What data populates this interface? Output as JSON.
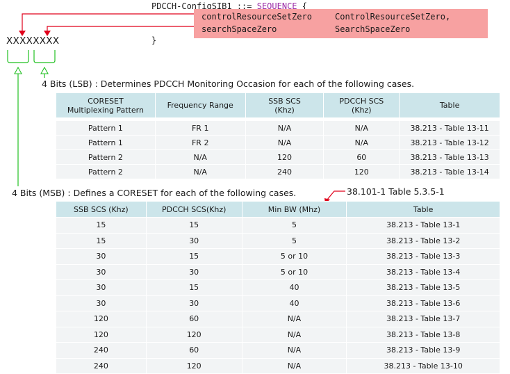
{
  "code": {
    "line1_name": "PDCCH-ConfigSIB1 ::=",
    "line1_kw": "SEQUENCE",
    "line1_brace": "{",
    "fields": [
      {
        "name": "controlResourceSetZero",
        "type": "ControlResourceSetZero,"
      },
      {
        "name": "searchSpaceZero",
        "type": "SearchSpaceZero"
      }
    ],
    "close": "}"
  },
  "bits": "XXXXXXXX",
  "lsb_label": "4 Bits (LSB) : Determines PDCCH Monitoring Occasion for each of the following cases.",
  "msb_label": "4 Bits (MSB) : Defines a CORESET for each of the following cases.",
  "ref_label": "38.101-1 Table 5.3.5-1",
  "colors": {
    "highlight": "#f7a1a1",
    "red_arrow": "#e0001b",
    "green_bracket": "#22c022",
    "header_bg": "#cce5ea",
    "cell_bg": "#f2f4f5",
    "keyword": "#9a2aa6"
  },
  "table1": {
    "headers": [
      [
        "CORESET",
        "Multiplexing Pattern"
      ],
      [
        "Frequency Range"
      ],
      [
        "SSB SCS",
        "(Khz)"
      ],
      [
        "PDCCH SCS",
        "(Khz)"
      ],
      [
        "Table"
      ]
    ],
    "rows": [
      [
        "Pattern 1",
        "FR 1",
        "N/A",
        "N/A",
        "38.213 - Table 13-11"
      ],
      [
        "Pattern 1",
        "FR 2",
        "N/A",
        "N/A",
        "38.213 - Table 13-12"
      ],
      [
        "Pattern 2",
        "N/A",
        "120",
        "60",
        "38.213 - Table 13-13"
      ],
      [
        "Pattern 2",
        "N/A",
        "240",
        "120",
        "38.213 - Table 13-14"
      ]
    ]
  },
  "table2": {
    "headers": [
      "SSB SCS (Khz)",
      "PDCCH SCS(Khz)",
      "Min BW (Mhz)",
      "Table"
    ],
    "rows": [
      [
        "15",
        "15",
        "5",
        "38.213 - Table 13-1"
      ],
      [
        "15",
        "30",
        "5",
        "38.213 - Table 13-2"
      ],
      [
        "30",
        "15",
        "5 or 10",
        "38.213 - Table 13-3"
      ],
      [
        "30",
        "30",
        "5 or 10",
        "38.213 - Table 13-4"
      ],
      [
        "30",
        "15",
        "40",
        "38.213 - Table 13-5"
      ],
      [
        "30",
        "30",
        "40",
        "38.213 - Table 13-6"
      ],
      [
        "120",
        "60",
        "N/A",
        "38.213 - Table 13-7"
      ],
      [
        "120",
        "120",
        "N/A",
        "38.213 - Table 13-8"
      ],
      [
        "240",
        "60",
        "N/A",
        "38.213 - Table 13-9"
      ],
      [
        "240",
        "120",
        "N/A",
        "38.213 - Table 13-10"
      ]
    ]
  }
}
